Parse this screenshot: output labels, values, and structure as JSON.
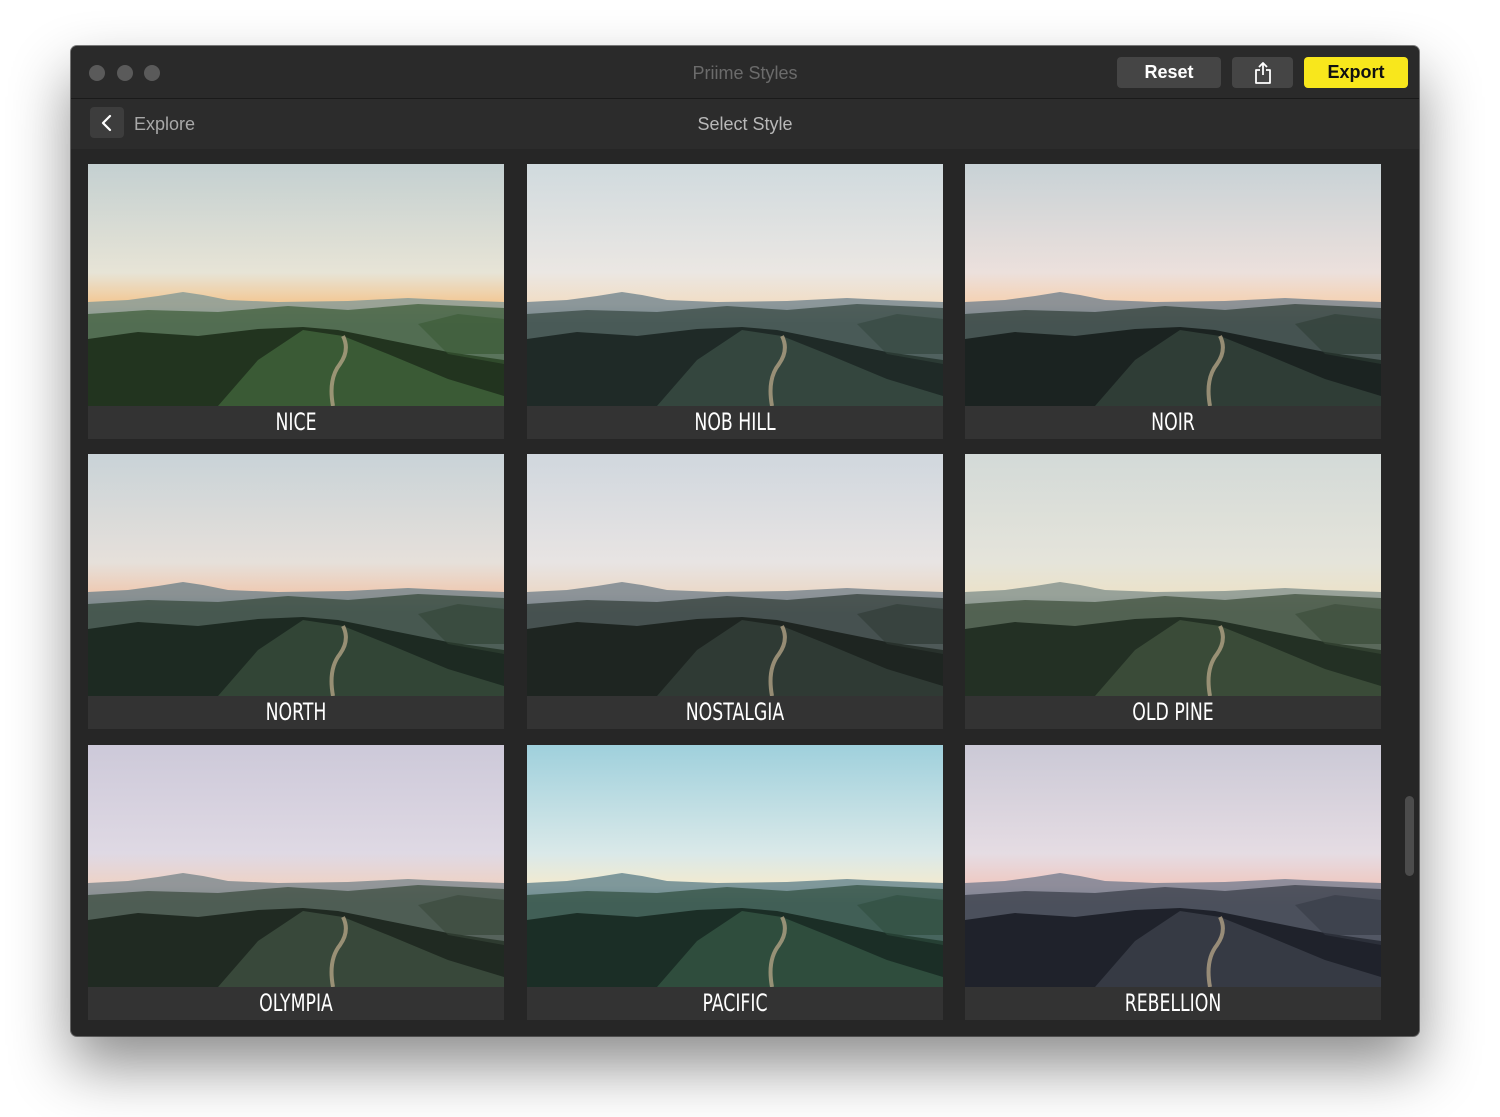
{
  "window": {
    "title": "Priime Styles"
  },
  "toolbar": {
    "reset_label": "Reset",
    "share_icon": "share-icon",
    "export_label": "Export",
    "export_color": "#f8e71c"
  },
  "navbar": {
    "back_icon": "chevron-left-icon",
    "back_label": "Explore",
    "title": "Select Style"
  },
  "styles": [
    {
      "name": "NICE",
      "sky_top": "#c4d0d1",
      "sky_mid": "#e7e4d6",
      "horizon": "#f3c792",
      "haze": "#8b9c97",
      "land": "#3a5a35",
      "land_dark": "#22341f"
    },
    {
      "name": "NOB HILL",
      "sky_top": "#d0dade",
      "sky_mid": "#ebe7e3",
      "horizon": "#f1ddc4",
      "haze": "#7a8b92",
      "land": "#34463e",
      "land_dark": "#1f2a27"
    },
    {
      "name": "NOIR",
      "sky_top": "#c8d2d6",
      "sky_mid": "#ece0dc",
      "horizon": "#f5d1b1",
      "haze": "#7b8790",
      "land": "#2f3d36",
      "land_dark": "#1b2321"
    },
    {
      "name": "NORTH",
      "sky_top": "#c9d3d8",
      "sky_mid": "#e6e0da",
      "horizon": "#efc9b1",
      "haze": "#78878d",
      "land": "#324536",
      "land_dark": "#1d2a22"
    },
    {
      "name": "NOSTALGIA",
      "sky_top": "#d0d7de",
      "sky_mid": "#e8e4e3",
      "horizon": "#ead8c7",
      "haze": "#7d878f",
      "land": "#2f3a34",
      "land_dark": "#1e2521"
    },
    {
      "name": "OLD PINE",
      "sky_top": "#d3dad8",
      "sky_mid": "#e5e4da",
      "horizon": "#ebe2c9",
      "haze": "#8a9690",
      "land": "#3a4b38",
      "land_dark": "#233024"
    },
    {
      "name": "OLYMPIA",
      "sky_top": "#cdc9d9",
      "sky_mid": "#dfd9e4",
      "horizon": "#eed2c6",
      "haze": "#838c90",
      "land": "#38483a",
      "land_dark": "#202a22"
    },
    {
      "name": "PACIFIC",
      "sky_top": "#9fd0dc",
      "sky_mid": "#dae9e9",
      "horizon": "#f2ead0",
      "haze": "#6b8a90",
      "land": "#2f4d3d",
      "land_dark": "#1b2e26"
    },
    {
      "name": "REBELLION",
      "sky_top": "#cbc9d6",
      "sky_mid": "#e5dce3",
      "horizon": "#efc9c2",
      "haze": "#7e8393",
      "land": "#363a44",
      "land_dark": "#1f222b"
    }
  ]
}
